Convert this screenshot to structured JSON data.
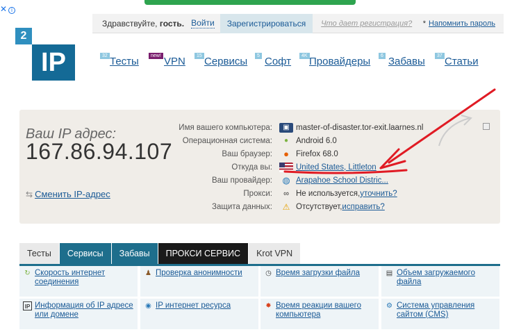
{
  "ad": {
    "close": "✕",
    "info": "i"
  },
  "topbar": {
    "hello_prefix": "Здравствуйте, ",
    "hello_user": "гость.",
    "login": "Войти",
    "register": "Зарегистрироваться",
    "why": "Что дает регистрация?",
    "remind_star": "*",
    "remind": "Напомнить пароль"
  },
  "logo": {
    "small": "2",
    "big": "IP"
  },
  "nav": [
    {
      "label": "Тесты",
      "badge": "32"
    },
    {
      "label": "VPN",
      "badge": "new!"
    },
    {
      "label": "Сервисы",
      "badge": "15"
    },
    {
      "label": "Софт",
      "badge": "5"
    },
    {
      "label": "Провайдеры",
      "badge": "4K"
    },
    {
      "label": "Забавы",
      "badge": "6"
    },
    {
      "label": "Статьи",
      "badge": "37"
    }
  ],
  "ip": {
    "heading": "Ваш IP адрес:",
    "address": "167.86.94.107",
    "change": "Сменить IP-адрес"
  },
  "info": [
    {
      "label": "Имя вашего компьютера:",
      "icon": "monitor-icon",
      "value": "master-of-disaster.tor-exit.laarnes.nl"
    },
    {
      "label": "Операционная система:",
      "icon": "android-icon",
      "value": "Android 6.0"
    },
    {
      "label": "Ваш браузер:",
      "icon": "firefox-icon",
      "value": "Firefox 68.0"
    },
    {
      "label": "Откуда вы:",
      "icon": "us-flag-icon",
      "value": "United States, Littleton"
    },
    {
      "label": "Ваш провайдер:",
      "icon": "globe-icon",
      "value": "Arapahoe School Distric..."
    },
    {
      "label": "Прокси:",
      "icon": "glasses-icon",
      "value": "Не используется, ",
      "link": "уточнить?"
    },
    {
      "label": "Защита данных:",
      "icon": "warning-icon",
      "value": "Отсутствует, ",
      "link": "исправить?"
    }
  ],
  "tabs": [
    "Тесты",
    "Сервисы",
    "Забавы",
    "ПРОКСИ СЕРВИС",
    "Krot VPN"
  ],
  "grid": [
    {
      "icon": "speed-icon",
      "text": "Скорость интернет соединения"
    },
    {
      "icon": "anonymity-icon",
      "text": "Проверка анонимности"
    },
    {
      "icon": "clock-icon",
      "text": "Время загрузки файла"
    },
    {
      "icon": "file-size-icon",
      "text": "Объем загружаемого файла"
    },
    {
      "icon": "ip-info-icon",
      "text": "Информация об IP адресе или домене"
    },
    {
      "icon": "ip-resource-icon",
      "text": "IP интернет ресурса"
    },
    {
      "icon": "response-time-icon",
      "text": "Время реакции вашего компьютера"
    },
    {
      "icon": "cms-icon",
      "text": "Система управления сайтом (CMS)"
    }
  ],
  "colors": {
    "accent": "#1e6e8c",
    "link": "#1a5a96",
    "annotation": "#e01b24"
  }
}
